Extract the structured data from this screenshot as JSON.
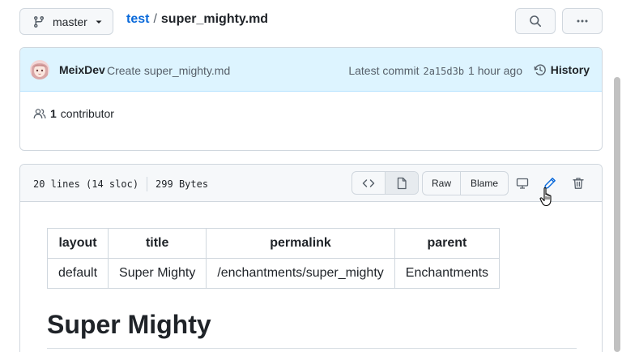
{
  "top": {
    "branch": "master",
    "repo": "test",
    "separator": "/",
    "file": "super_mighty.md"
  },
  "commit": {
    "author": "MeixDev",
    "message": "Create super_mighty.md",
    "latest_label": "Latest commit",
    "hash": "2a15d3b",
    "time": "1 hour ago",
    "history_label": "History"
  },
  "contributors": {
    "count": "1",
    "label": "contributor"
  },
  "file": {
    "lines": "20 lines (14 sloc)",
    "size": "299 Bytes",
    "raw_label": "Raw",
    "blame_label": "Blame"
  },
  "table": {
    "headers": [
      "layout",
      "title",
      "permalink",
      "parent"
    ],
    "row": [
      "default",
      "Super Mighty",
      "/enchantments/super_mighty",
      "Enchantments"
    ]
  },
  "doc": {
    "title": "Super Mighty"
  },
  "colors": {
    "link": "#0969da",
    "commit_bg": "#ddf4ff",
    "edit_icon": "#0969da",
    "border": "#d0d7de"
  },
  "icons": [
    "git-branch-icon",
    "chevron-down-icon",
    "search-icon",
    "kebab-horizontal-icon",
    "history-icon",
    "people-icon",
    "code-icon",
    "file-icon",
    "desktop-icon",
    "pencil-icon",
    "trash-icon",
    "hand-pointer-icon"
  ]
}
